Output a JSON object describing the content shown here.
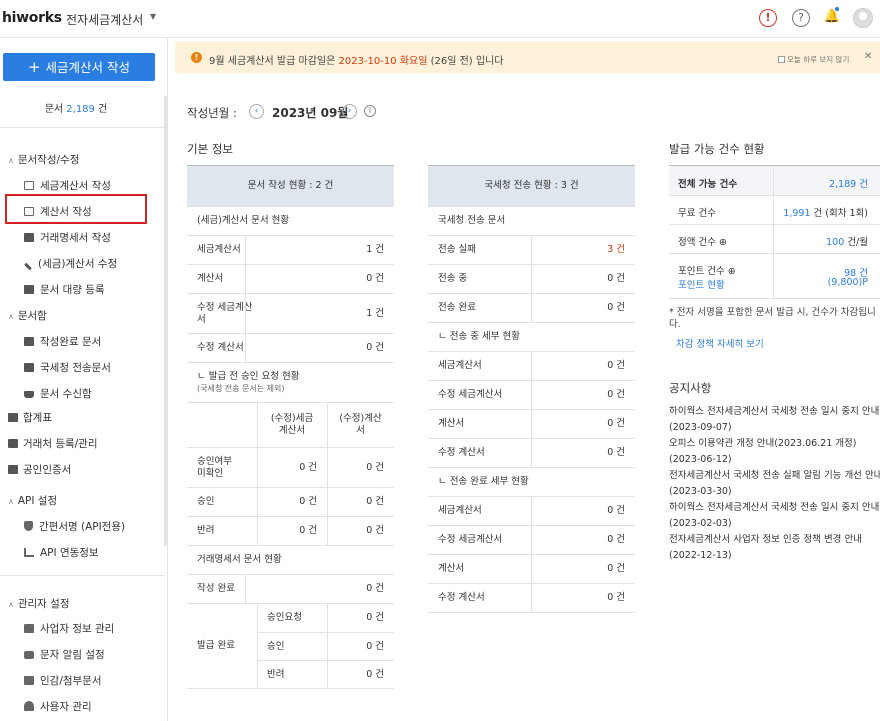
{
  "topbar": {
    "logo": "hiworks",
    "app_name": "전자세금계산서",
    "alert_glyph": "!",
    "help_glyph": "?"
  },
  "sidebar": {
    "create_button": "세금계산서 작성",
    "doc_count_label": "문서",
    "doc_count_value": "2,189",
    "doc_count_unit": "건",
    "section_write": "문서작성/수정",
    "items_write": [
      "세금계산서 작성",
      "계산서 작성",
      "거래명세서 작성",
      "(세금)계산서 수정",
      "문서 대량 등록"
    ],
    "section_box": "문서함",
    "items_box": [
      "작성완료 문서",
      "국세청 전송문서",
      "문서 수신함"
    ],
    "item_summary": "합계표",
    "item_partner": "거래처 등록/관리",
    "item_cert": "공인인증서",
    "section_api": "API 설정",
    "items_api": [
      "간편서명 (API전용)",
      "API 연동정보"
    ],
    "section_admin": "관리자 설정",
    "items_admin": [
      "사업자 정보 관리",
      "문자 알림 설정",
      "인감/첨부문서",
      "사용자 관리"
    ]
  },
  "notice": {
    "prefix": "9월 세금계산서 발급 마감일은",
    "date": "2023-10-10 화요일",
    "suffix": "(26일 전) 입니다",
    "checkbox": "오늘 하루 보지 않기",
    "close": "✕"
  },
  "period": {
    "label": "작성년월 :",
    "value": "2023년 09월"
  },
  "basic_title": "기본 정보",
  "doc_status": {
    "header": "문서 작성 현황 : 2 건",
    "sec1": "(세금)계산서 문서 현황",
    "rows1": [
      {
        "label": "세금계산서",
        "value": "1 건"
      },
      {
        "label": "계산서",
        "value": "0 건"
      },
      {
        "label": "수정 세금계산서",
        "value": "1 건"
      },
      {
        "label": "수정 계산서",
        "value": "0 건"
      }
    ],
    "sec2": "ㄴ 발급 전 승인 요청 현황",
    "sec2_note": "(국세청 전송 문서는 제외)",
    "col_a": "(수정)세금계산서",
    "col_b": "(수정)계산서",
    "rows2": [
      {
        "label": "승인여부 미확인",
        "a": "0 건",
        "b": "0 건"
      },
      {
        "label": "승인",
        "a": "0 건",
        "b": "0 건"
      },
      {
        "label": "반려",
        "a": "0 건",
        "b": "0 건"
      }
    ],
    "sec3": "거래명세서 문서 현황",
    "done_label": "작성 완료",
    "done_value": "0 건",
    "issued_label": "발급 완료",
    "rows3": [
      {
        "label": "승인요청",
        "value": "0 건"
      },
      {
        "label": "승인",
        "value": "0 건"
      },
      {
        "label": "반려",
        "value": "0 건"
      }
    ]
  },
  "nts_status": {
    "header": "국세청 전송 현황 : 3 건",
    "sec1": "국세청 전송 문서",
    "rows1": [
      {
        "label": "전송 실패",
        "value": "3 건"
      },
      {
        "label": "전송 중",
        "value": "0 건"
      },
      {
        "label": "전송 완료",
        "value": "0 건"
      }
    ],
    "sec2": "ㄴ 전송 중 세부 현황",
    "rows2": [
      {
        "label": "세금계산서",
        "value": "0 건"
      },
      {
        "label": "수정 세금계산서",
        "value": "0 건"
      },
      {
        "label": "계산서",
        "value": "0 건"
      },
      {
        "label": "수정 계산서",
        "value": "0 건"
      }
    ],
    "sec3": "ㄴ 전송 완료 세부 현황",
    "rows3": [
      {
        "label": "세금계산서",
        "value": "0 건"
      },
      {
        "label": "수정 세금계산서",
        "value": "0 건"
      },
      {
        "label": "계산서",
        "value": "0 건"
      },
      {
        "label": "수정 계산서",
        "value": "0 건"
      }
    ]
  },
  "issuable": {
    "title": "발급 가능 건수 현황",
    "total_label": "전체 가능 건수",
    "total_value": "2,189 건",
    "free_label": "무료 건수",
    "free_value": "1,991",
    "free_suffix": "건 (회차 1회)",
    "fixed_label": "정액 건수 ⊕",
    "fixed_value": "100",
    "fixed_suffix": "건/월",
    "point_label": "포인트 건수 ⊕",
    "point_link": "포인트 현황",
    "point_value": "98 건",
    "point_sub": "(9,800)P",
    "note": "* 전자 서명을 포함한 문서 발급 시, 건수가 차감됩니다.",
    "link": "차감 정책 자세히 보기"
  },
  "notices": {
    "title": "공지사항",
    "items": [
      {
        "title": "하이웍스 전자세금계산서 국세청 전송 일시 중지 안내",
        "date": "(2023-09-07)"
      },
      {
        "title": "오피스 이용약관 개정 안내(2023.06.21 개정)",
        "date": "(2023-06-12)"
      },
      {
        "title": "전자세금계산서 국세청 전송 실패 알림 기능 개선 안내",
        "date": "(2023-03-30)"
      },
      {
        "title": "하이웍스 전자세금계산서 국세청 전송 일시 중지 안내",
        "date": "(2023-02-03)"
      },
      {
        "title": "전자세금계산서 사업자 정보 인증 정책 변경 안내",
        "date": "(2022-12-13)"
      }
    ]
  }
}
